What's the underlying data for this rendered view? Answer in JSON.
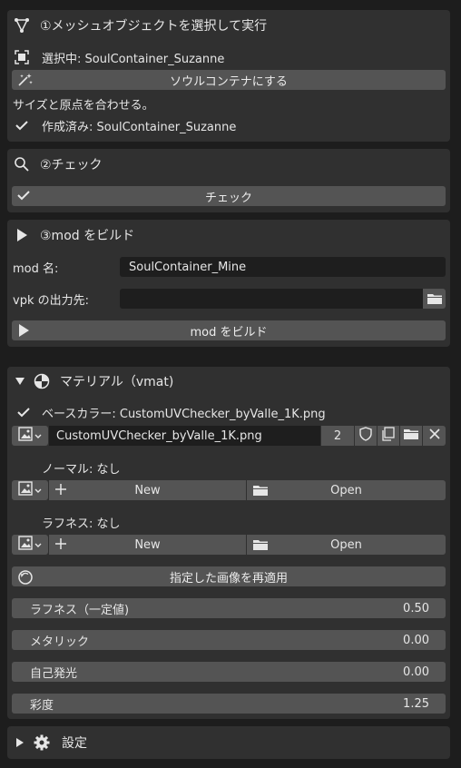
{
  "section1": {
    "title": "①メッシュオブジェクトを選択して実行",
    "selected_label": "選択中: SoulContainer_Suzanne",
    "make_button": "ソウルコンテナにする",
    "info": "サイズと原点を合わせる。",
    "created_label": "作成済み: SoulContainer_Suzanne"
  },
  "section2": {
    "title": "②チェック",
    "check_button": "チェック"
  },
  "section3": {
    "title": "③mod をビルド",
    "mod_name_label": "mod 名:",
    "mod_name_value": "SoulContainer_Mine",
    "vpk_label": "vpk の出力先:",
    "vpk_value": "",
    "build_button": "mod をビルド"
  },
  "material": {
    "title": "マテリアル（vmat)",
    "base_color_label": "ベースカラー: CustomUVChecker_byValle_1K.png",
    "base_image_name": "CustomUVChecker_byValle_1K.png",
    "base_image_users": "2",
    "normal_label": "ノーマル: なし",
    "roughness_label": "ラフネス: なし",
    "new_label": "New",
    "open_label": "Open",
    "reapply_button": "指定した画像を再適用",
    "sliders": [
      {
        "label": "ラフネス（一定値)",
        "value": "0.50"
      },
      {
        "label": "メタリック",
        "value": "0.00"
      },
      {
        "label": "自己発光",
        "value": "0.00"
      },
      {
        "label": "彩度",
        "value": "1.25"
      }
    ]
  },
  "settings": {
    "title": "設定"
  }
}
